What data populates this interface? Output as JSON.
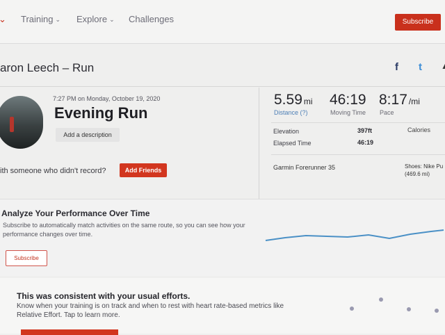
{
  "nav": {
    "items": [
      {
        "label": "Training"
      },
      {
        "label": "Explore"
      },
      {
        "label": "Challenges"
      }
    ],
    "subscribe_label": "Subscribe"
  },
  "header": {
    "title": "aron Leech – Run",
    "social": [
      "f",
      "t"
    ]
  },
  "activity": {
    "datetime": "7:27 PM on Monday, October 19, 2020",
    "name": "Evening Run",
    "add_description": "Add a description",
    "friends_prompt": "ith someone who didn't record?",
    "add_friends_label": "Add Friends"
  },
  "stats": {
    "distance": {
      "value": "5.59",
      "unit": "mi",
      "label": "Distance (?)"
    },
    "moving_time": {
      "value": "46:19",
      "label": "Moving Time"
    },
    "pace": {
      "value": "8:17",
      "unit": "/mi",
      "label": "Pace"
    },
    "elevation": {
      "label": "Elevation",
      "value": "397ft"
    },
    "elapsed_time": {
      "label": "Elapsed Time",
      "value": "46:19"
    },
    "calories_label": "Calories",
    "device": "Garmin Forerunner 35",
    "shoes_line1": "Shoes: Nike Pu",
    "shoes_line2": "(469.6 mi)"
  },
  "analyze": {
    "title": "Analyze Your Performance Over Time",
    "text": "Subscribe to automatically match activities on the same route, so you can see how your performance changes over time.",
    "subscribe_label": "Subscribe"
  },
  "consistency": {
    "title": "This was consistent with your usual efforts.",
    "text": "Know when your training is on track and when to rest with heart rate-based metrics like Relative Effort. Tap to learn more."
  },
  "colors": {
    "accent": "#d2361f",
    "link_blue": "#4d7fb6",
    "chart_line": "#4a90c6"
  }
}
